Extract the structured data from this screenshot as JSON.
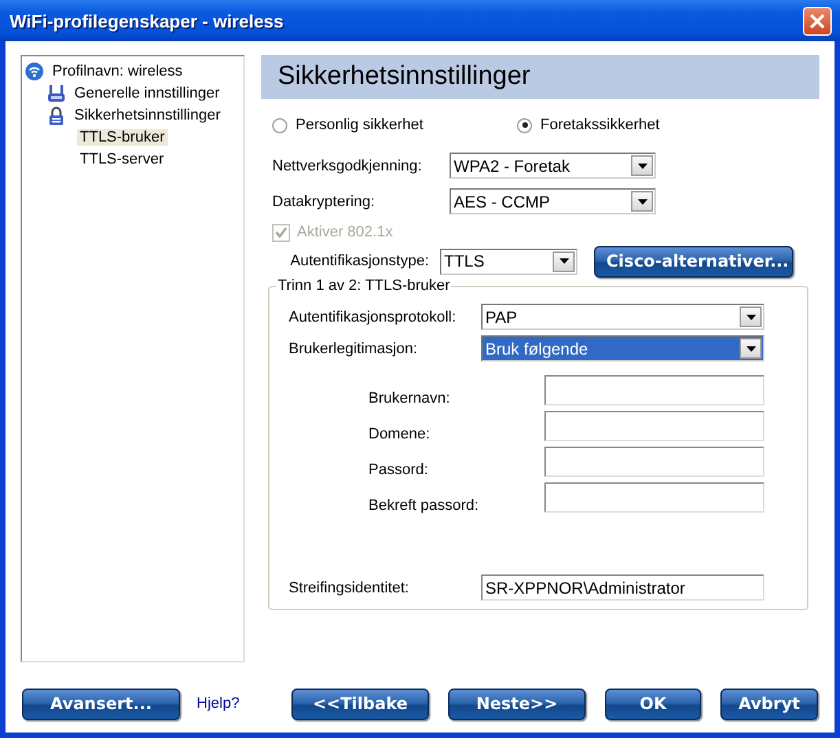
{
  "window": {
    "title": "WiFi-profilegenskaper - wireless"
  },
  "tree": [
    {
      "label": "Profilnavn: wireless",
      "kind": "wifi",
      "selected": false,
      "children": [
        {
          "label": "Generelle innstillinger",
          "kind": "network",
          "selected": false
        },
        {
          "label": "Sikkerhetsinnstillinger",
          "kind": "lock",
          "selected": false,
          "children": [
            {
              "label": "TTLS-bruker",
              "selected": true
            },
            {
              "label": "TTLS-server",
              "selected": false
            }
          ]
        }
      ]
    }
  ],
  "header": "Sikkerhetsinnstillinger",
  "security_mode": [
    {
      "label": "Personlig sikkerhet",
      "selected": false
    },
    {
      "label": "Foretakssikkerhet",
      "selected": true
    }
  ],
  "network_auth": {
    "label": "Nettverksgodkjenning:",
    "value": "WPA2 - Foretak"
  },
  "encryption": {
    "label": "Datakryptering:",
    "value": "AES - CCMP"
  },
  "enable_8021x": {
    "label": "Aktiver 802.1x",
    "checked": true,
    "disabled": true
  },
  "auth_type": {
    "label": "Autentifikasjonstype:",
    "value": "TTLS"
  },
  "cisco_button": "Cisco-alternativer...",
  "group": {
    "title": "Trinn 1 av 2: TTLS-bruker",
    "selects": [
      {
        "label": "Autentifikasjonsprotokoll:",
        "value": "PAP",
        "highlighted": false
      },
      {
        "label": "Brukerlegitimasjon:",
        "value": "Bruk følgende",
        "highlighted": true
      }
    ],
    "credentials": [
      {
        "label": "Brukernavn:"
      },
      {
        "label": "Domene:"
      },
      {
        "label": "Passord:"
      },
      {
        "label": "Bekreft passord:"
      }
    ],
    "roaming": {
      "label": "Streifingsidentitet:",
      "value": "SR-XPPNOR\\Administrator"
    }
  },
  "footer": {
    "advanced": "Avansert...",
    "help": "Hjelp?",
    "buttons": [
      "<<Tilbake",
      "Neste>>",
      "OK",
      "Avbryt"
    ]
  }
}
